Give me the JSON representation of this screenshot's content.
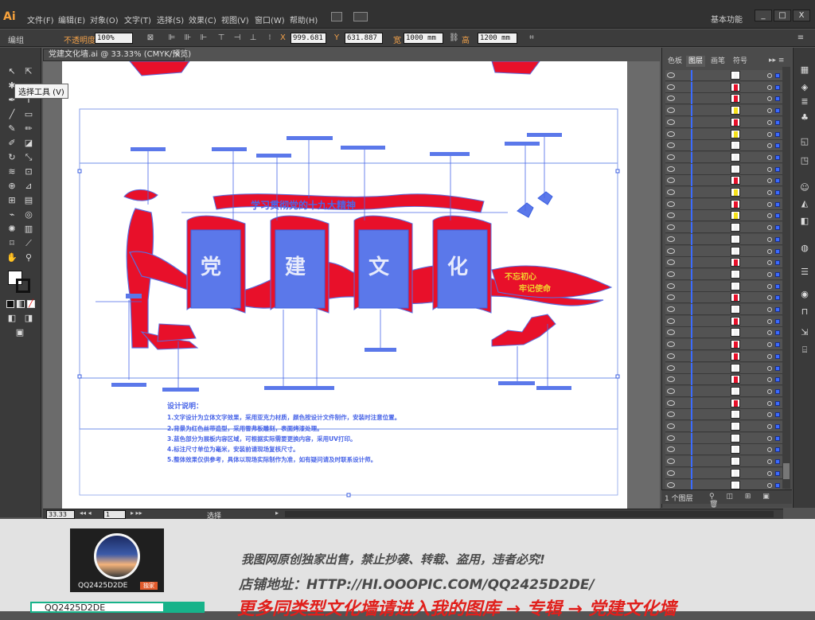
{
  "app": {
    "logo": "Ai",
    "menu": [
      "文件(F)",
      "编辑(E)",
      "对象(O)",
      "文字(T)",
      "选择(S)",
      "效果(C)",
      "视图(V)",
      "窗口(W)",
      "帮助(H)"
    ],
    "workspace": "基本功能",
    "window_buttons": [
      "_",
      "□",
      "X"
    ]
  },
  "control_bar": {
    "selection_label": "编组",
    "opacity_label": "不透明度",
    "opacity_value": "100%",
    "x_label": "X",
    "x_value": "999.681",
    "y_label": "Y",
    "y_value": "631.887",
    "w_label": "宽",
    "w_value": "1000 mm",
    "h_label": "高",
    "h_value": "1200 mm"
  },
  "tools": {
    "tooltip": "选择工具 (V)"
  },
  "document": {
    "tab_title": "党建文化墙.ai @ 33.33% (CMYK/预览)",
    "zoom": "33.33",
    "page": "1",
    "status": "选择"
  },
  "artwork": {
    "banner_title": "学习贯彻党的十九大精神",
    "slogan_lines": [
      "不忘初心",
      "牢记使命"
    ],
    "panel_titles": [
      "党",
      "建",
      "文",
      "化"
    ],
    "notes_heading": "设计说明：",
    "notes_lines": [
      "1.文字设计为立体文字效果，采用亚克力材质，颜色按设计文件制作，安装时注意位置。",
      "2.背景为红色丝带造型，采用雪弗板雕刻，表面烤漆处理。",
      "3.蓝色部分为展板内容区域，可根据实际需要更换内容，采用UV打印。",
      "4.标注尺寸单位为毫米，安装前请现场复核尺寸。",
      "5.整体效果仅供参考，具体以现场实际制作为准，如有疑问请及时联系设计师。"
    ]
  },
  "layers_panel": {
    "tabs": [
      "色板",
      "图层",
      "画笔",
      "符号"
    ],
    "active_tab": "图层",
    "count_label": "1 个图层",
    "thumbnails": [
      "white",
      "red",
      "red",
      "yellow",
      "red",
      "yellow",
      "white",
      "white",
      "white",
      "red",
      "yellow",
      "red",
      "yellow",
      "white",
      "white",
      "white",
      "red",
      "white",
      "white",
      "red",
      "white",
      "red",
      "white",
      "red",
      "red",
      "white",
      "red",
      "white",
      "red",
      "white",
      "white",
      "white",
      "white",
      "white",
      "white",
      "white",
      "white"
    ]
  },
  "banner": {
    "avatar_name": "QQ2425D2DE",
    "avatar_badge": "独家",
    "notice": "我图网原创独家出售，禁止抄袭、转载、盗用，违者必究!",
    "shop": "店铺地址：HTTP://HI.OOOPIC.COM/QQ2425D2DE/",
    "promo": "更多同类型文化墙请进入我的图库 → 专辑 → 党建文化墙",
    "search_value": "QQ2425D2DE"
  },
  "colors": {
    "art_red": "#e8102a",
    "art_blue": "#4a66e8",
    "ui_dark": "#323232"
  }
}
